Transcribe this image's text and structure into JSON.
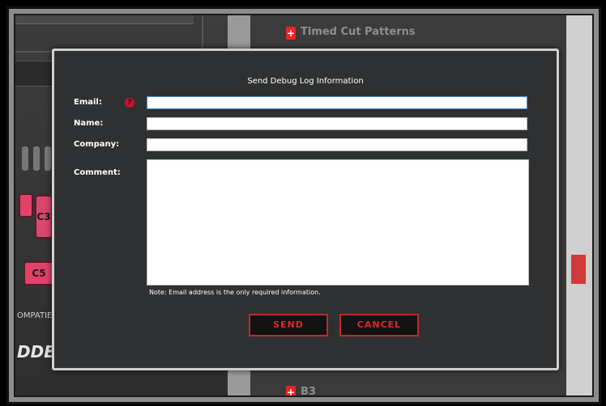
{
  "background": {
    "left": {
      "buttons": [
        "C5",
        "C3"
      ],
      "caption": "OMPATIE",
      "logo_fragment": "DDE"
    },
    "right": {
      "heading": "Timed Cut Patterns",
      "bottom_item": "B3"
    }
  },
  "dialog": {
    "title": "Send Debug Log Information",
    "email_label": "Email:",
    "name_label": "Name:",
    "company_label": "Company:",
    "comment_label": "Comment:",
    "help_icon": "?",
    "email_value": "",
    "name_value": "",
    "company_value": "",
    "comment_value": "",
    "note": "Note: Email address is the only required information.",
    "send_label": "SEND",
    "cancel_label": "CANCEL"
  },
  "colors": {
    "modal_bg": "#2f3031",
    "accent_red": "#c1272d",
    "pink": "#e0426a"
  }
}
